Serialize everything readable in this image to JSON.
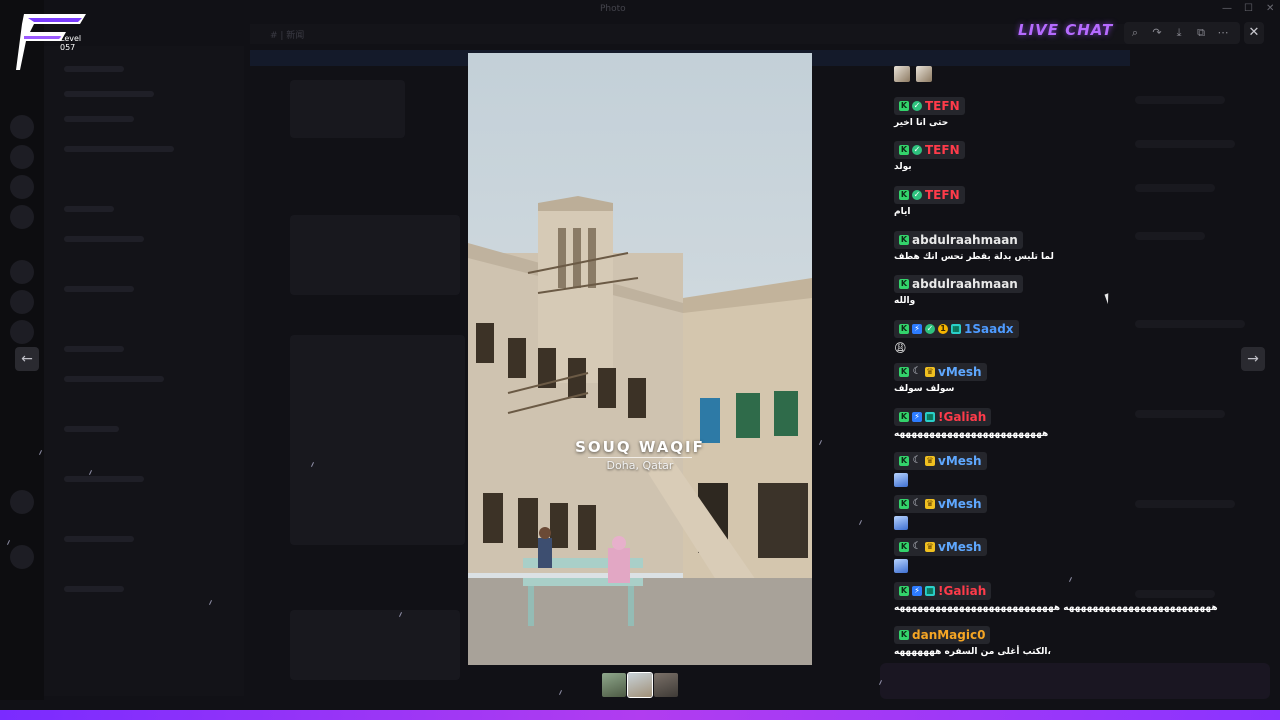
{
  "window": {
    "title": "Photo",
    "background_channel": "# | 新闻",
    "min_glyph": "—",
    "max_glyph": "☐",
    "close_glyph": "✕"
  },
  "overlay": {
    "live_chat_title": "LIVE CHAT",
    "logo_level": "Level 057"
  },
  "viewer": {
    "place_title": "SOUQ WAQIF",
    "place_subtitle": "Doha, Qatar",
    "prev_icon": "←",
    "next_icon": "→",
    "close_icon": "✕",
    "toolbar": [
      {
        "name": "zoom-icon",
        "glyph": "⌕"
      },
      {
        "name": "share-icon",
        "glyph": "↷"
      },
      {
        "name": "download-icon",
        "glyph": "⤓"
      },
      {
        "name": "open-external-icon",
        "glyph": "⧉"
      },
      {
        "name": "more-icon",
        "glyph": "⋯"
      }
    ]
  },
  "chat": {
    "messages": [
      {
        "user": "TEFN",
        "color": "#ff3b4a",
        "badges": [
          "k",
          "check"
        ],
        "text": "حتى انا اخير"
      },
      {
        "user": "TEFN",
        "color": "#ff3b4a",
        "badges": [
          "k",
          "check"
        ],
        "text": "بولد"
      },
      {
        "user": "TEFN",
        "color": "#ff3b4a",
        "badges": [
          "k",
          "check"
        ],
        "text": "ايام"
      },
      {
        "user": "abdulraahmaan",
        "color": "#e8e8e8",
        "badges": [
          "k"
        ],
        "text": "لما تلبس بدلة بقطر تحس انك هطف"
      },
      {
        "user": "abdulraahmaan",
        "color": "#e8e8e8",
        "badges": [
          "k"
        ],
        "text": "والله"
      },
      {
        "user": "1Saadx",
        "color": "#4e9bff",
        "badges": [
          "k",
          "blue",
          "check",
          "gold",
          "grid"
        ],
        "text": "😩"
      },
      {
        "user": "vMesh",
        "color": "#5fa8ff",
        "badges": [
          "k",
          "moon",
          "crown"
        ],
        "text": "سولف سولف"
      },
      {
        "user": "!Galiah",
        "color": "#ff3b4a",
        "badges": [
          "k",
          "blue",
          "grid"
        ],
        "text": "هههههههههههههههههههههههههه"
      },
      {
        "user": "vMesh",
        "color": "#5fa8ff",
        "badges": [
          "k",
          "moon",
          "crown"
        ],
        "text": ""
      },
      {
        "user": "vMesh",
        "color": "#5fa8ff",
        "badges": [
          "k",
          "moon",
          "crown"
        ],
        "text": ""
      },
      {
        "user": "vMesh",
        "color": "#5fa8ff",
        "badges": [
          "k",
          "moon",
          "crown"
        ],
        "text": ""
      },
      {
        "user": "!Galiah",
        "color": "#ff3b4a",
        "badges": [
          "k",
          "blue",
          "grid"
        ],
        "text": "هههههههههههههههههههههههههه هههههههههههههههههههههههههههه"
      },
      {
        "user": "danMagic0",
        "color": "#f5a524",
        "badges": [
          "k"
        ],
        "text": "الكتب أغلى من السفره هههههههه،"
      }
    ]
  }
}
